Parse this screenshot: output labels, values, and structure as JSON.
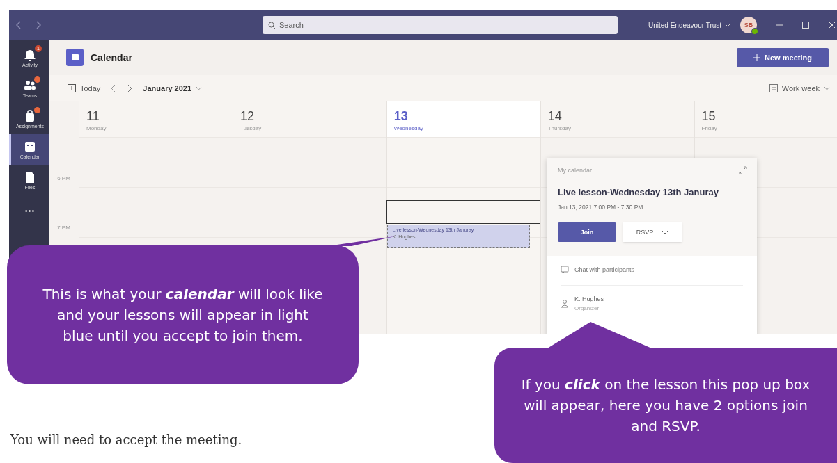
{
  "app": {
    "top_bar": {
      "search_placeholder": "Search",
      "organization": "United Endeavour Trust",
      "avatar_initials": "SB"
    },
    "rail": [
      {
        "label": "Activity",
        "badge": "1",
        "selected": false
      },
      {
        "label": "Teams",
        "dot": true,
        "selected": false
      },
      {
        "label": "Assignments",
        "dot": true,
        "selected": false
      },
      {
        "label": "Calendar",
        "dot": false,
        "selected": true
      },
      {
        "label": "Files",
        "dot": false,
        "selected": false
      },
      {
        "label": "•••",
        "dot": false,
        "selected": false
      }
    ],
    "header": {
      "title": "Calendar",
      "new_meeting": "New meeting"
    },
    "toolbar": {
      "today": "Today",
      "month": "January 2021",
      "view": "Work week"
    },
    "days": [
      {
        "number": "11",
        "name": "Monday",
        "selected": false
      },
      {
        "number": "12",
        "name": "Tuesday",
        "selected": false
      },
      {
        "number": "13",
        "name": "Wednesday",
        "selected": true,
        "events": [
          {
            "title": "Live lesson-Wednesday 13th Januray",
            "organizer": "K. Hughes"
          }
        ]
      },
      {
        "number": "14",
        "name": "Thursday",
        "selected": false
      },
      {
        "number": "15",
        "name": "Friday",
        "selected": false
      }
    ],
    "time_labels": [
      "6 PM",
      "7 PM"
    ],
    "popup": {
      "calendar": "My calendar",
      "title": "Live lesson-Wednesday 13th Januray",
      "time": "Jan 13, 2021 7:00 PM - 7:30 PM",
      "join": "Join",
      "rsvp": "RSVP",
      "chat": "Chat with participants",
      "organizer": "K. Hughes",
      "role": "Organizer"
    }
  },
  "callouts": [
    {
      "text": "This is what your **calendar** will look like and your lessons will appear in light blue until you accept to join them."
    },
    {
      "text": "If you **click** on the lesson this pop up box will appear, here you have 2 options join and RSVP."
    }
  ],
  "body_text": "You will need to accept the meeting."
}
